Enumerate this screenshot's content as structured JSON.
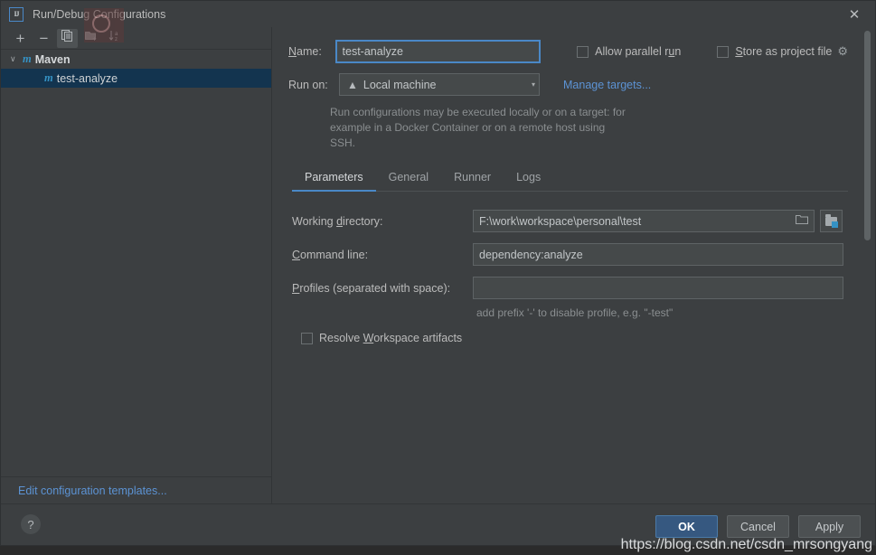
{
  "window": {
    "title": "Run/Debug Configurations",
    "app_icon": "intellij-idea-icon",
    "close_icon": "close-icon"
  },
  "toolbar": {
    "add_label": "+",
    "remove_label": "−",
    "copy_icon": "copy-icon",
    "new_folder_icon": "new-folder-icon",
    "sort_icon": "sort-alphabetically-icon"
  },
  "tree": {
    "group_label": "Maven",
    "group_icon": "maven-icon",
    "chevron": "∨",
    "item_label": "test-analyze",
    "item_icon": "maven-icon",
    "selected": "test-analyze"
  },
  "left_footer": {
    "edit_templates_label": "Edit configuration templates..."
  },
  "form": {
    "name_label": "Name:",
    "name_underline": "N",
    "name_value": "test-analyze",
    "name_placeholder": "",
    "allow_parallel_run_label": "Allow parallel run",
    "allow_parallel_run_checked": false,
    "store_as_project_file_label": "Store as project file",
    "store_as_project_file_checked": false,
    "gear_icon": "gear-icon",
    "run_on_label": "Run on:",
    "run_on_value": "Local machine",
    "run_on_icon": "home-icon",
    "run_on_arrow": "▾",
    "manage_targets_label": "Manage targets...",
    "hint_line1": "Run configurations may be executed locally or on a target: for",
    "hint_line2": "example in a Docker Container or on a remote host using SSH."
  },
  "tabs": [
    {
      "label": "Parameters",
      "active": true
    },
    {
      "label": "General",
      "active": false
    },
    {
      "label": "Runner",
      "active": false
    },
    {
      "label": "Logs",
      "active": false
    }
  ],
  "parameters": {
    "working_directory_label": "Working directory:",
    "working_directory_value": "F:\\work\\workspace\\personal\\test",
    "browse_icon": "folder-open-icon",
    "macro_icon": "module-folder-icon",
    "command_line_label": "Command line:",
    "command_line_value": "dependency:analyze",
    "profiles_label": "Profiles (separated with space):",
    "profiles_value": "",
    "profiles_placeholder": "",
    "profiles_hint": "add prefix '-' to disable profile, e.g. \"-test\"",
    "resolve_workspace_label": "Resolve Workspace artifacts",
    "resolve_workspace_checked": false
  },
  "bottom": {
    "help_label": "?",
    "ok_label": "OK",
    "cancel_label": "Cancel",
    "apply_label": "Apply"
  },
  "watermark": {
    "text": "https://blog.csdn.net/csdn_mrsongyang"
  },
  "colors": {
    "dialog_bg": "#3c3f41",
    "accent_blue": "#4a88c7",
    "selection_blue": "#13344f",
    "primary_button": "#365880",
    "link_blue": "#5c93d4",
    "maven_icon": "#3592c4"
  }
}
